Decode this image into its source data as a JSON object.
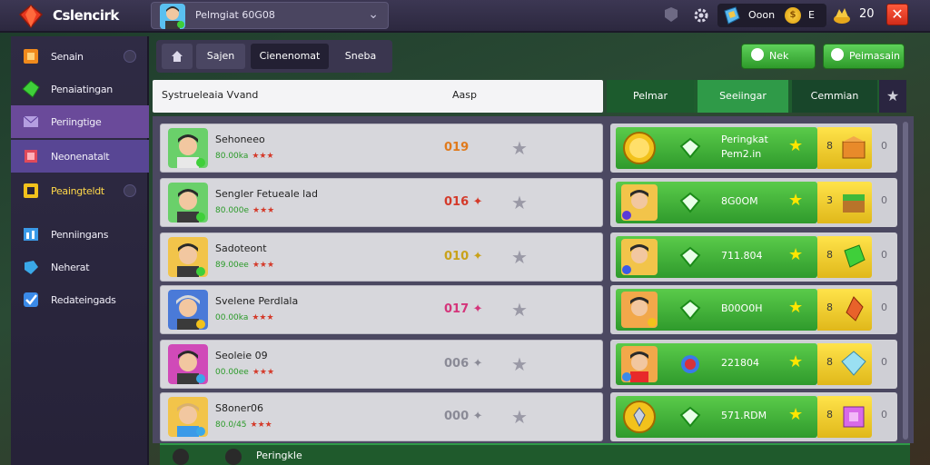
{
  "header": {
    "app_title": "Cslencirk",
    "profile_name": "Pelmgiat 60G08",
    "currency_label": "Ooon",
    "coin_symbol": "$",
    "currency_count": "E",
    "gold_value": "20"
  },
  "sidebar": {
    "items": [
      {
        "label": "Senain",
        "icon": "orange-square-icon"
      },
      {
        "label": "Penaiatingan",
        "icon": "green-gem-icon"
      },
      {
        "label": "Periingtige",
        "icon": "mail-icon"
      },
      {
        "label": "Neonenatalt",
        "icon": "card-icon"
      },
      {
        "label": "Peaingteldt",
        "icon": "frame-icon"
      },
      {
        "label": "Penniingans",
        "icon": "chart-icon"
      },
      {
        "label": "Neherat",
        "icon": "tag-icon"
      },
      {
        "label": "Redateingads",
        "icon": "check-icon"
      }
    ]
  },
  "tabs": {
    "t1": "Sajen",
    "t2": "Cienenomat",
    "t3": "Sneba"
  },
  "buttons": {
    "new": "Nek",
    "premium": "Peimasain"
  },
  "left_table": {
    "col1": "Systrueleaia Vvand",
    "col2": "Aasp",
    "rows": [
      {
        "name": "Sehoneeo",
        "sub": "80.00ka",
        "rating": "★★★",
        "score": "019",
        "score_color": "#e07a1c"
      },
      {
        "name": "Sengler Fetueale lad",
        "sub": "80.000e",
        "rating": "★★★",
        "score": "016 ✦",
        "score_color": "#d43a2a"
      },
      {
        "name": "Sadoteont",
        "sub": "89.00ee",
        "rating": "★★★",
        "score": "010 ✦",
        "score_color": "#c9a21a"
      },
      {
        "name": "Svelene Perdlala",
        "sub": "00.00ka",
        "rating": "★★★",
        "score": "017 ✦",
        "score_color": "#d4347a"
      },
      {
        "name": "Seoleie 09",
        "sub": "00.00ee",
        "rating": "★★★",
        "score": "006 ✦",
        "score_color": "#8a8a96"
      },
      {
        "name": "S8oner06",
        "sub": "80.0/45",
        "rating": "★★★",
        "score": "000 ✦",
        "score_color": "#8a8a96"
      }
    ]
  },
  "right_table": {
    "tabs": [
      "Pelmar",
      "Seeiingar",
      "Cemmian"
    ],
    "rows": [
      {
        "value": "Peringkat Pem2.in",
        "qty": "8",
        "zero": "0"
      },
      {
        "value": "8G0OM",
        "qty": "3",
        "zero": "0"
      },
      {
        "value": "711.804",
        "qty": "8",
        "zero": "0"
      },
      {
        "value": "B00O0H",
        "qty": "8",
        "zero": "0"
      },
      {
        "value": "221804",
        "qty": "8",
        "zero": "0"
      },
      {
        "value": "571.RDM",
        "qty": "8",
        "zero": "0"
      }
    ]
  },
  "bottom": {
    "label": "Peringkle"
  }
}
